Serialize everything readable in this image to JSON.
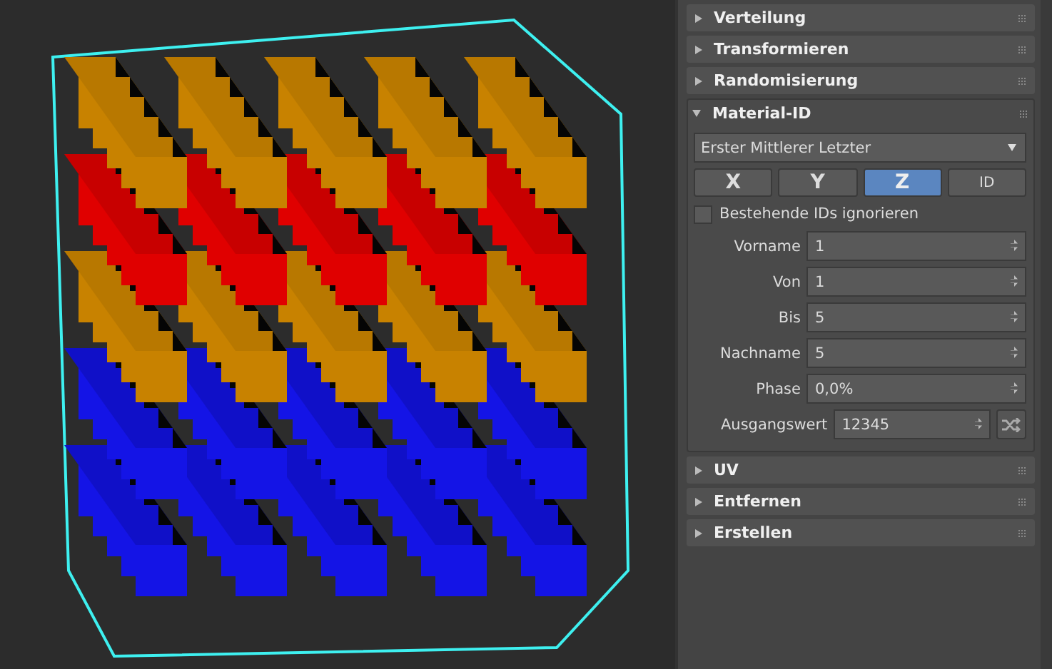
{
  "rollouts_top": [
    {
      "title": "Verteilung",
      "expanded": false
    },
    {
      "title": "Transformieren",
      "expanded": false
    },
    {
      "title": "Randomisierung",
      "expanded": false
    }
  ],
  "material_id": {
    "title": "Material-ID",
    "expanded": true,
    "dropdown": {
      "value": "Erster Mittlerer Letzter"
    },
    "axis_buttons": [
      {
        "label": "X",
        "selected": false
      },
      {
        "label": "Y",
        "selected": false
      },
      {
        "label": "Z",
        "selected": true
      },
      {
        "label": "ID",
        "selected": false
      }
    ],
    "ignore_checkbox": {
      "label": "Bestehende IDs ignorieren",
      "checked": false
    },
    "fields": [
      {
        "label": "Vorname",
        "value": "1"
      },
      {
        "label": "Von",
        "value": "1"
      },
      {
        "label": "Bis",
        "value": "5"
      },
      {
        "label": "Nachname",
        "value": "5"
      },
      {
        "label": "Phase",
        "value": "0,0%"
      }
    ],
    "seed": {
      "label": "Ausgangswert",
      "value": "12345"
    }
  },
  "rollouts_bottom": [
    {
      "title": "UV",
      "expanded": false
    },
    {
      "title": "Entfernen",
      "expanded": false
    },
    {
      "title": "Erstellen",
      "expanded": false
    }
  ]
}
